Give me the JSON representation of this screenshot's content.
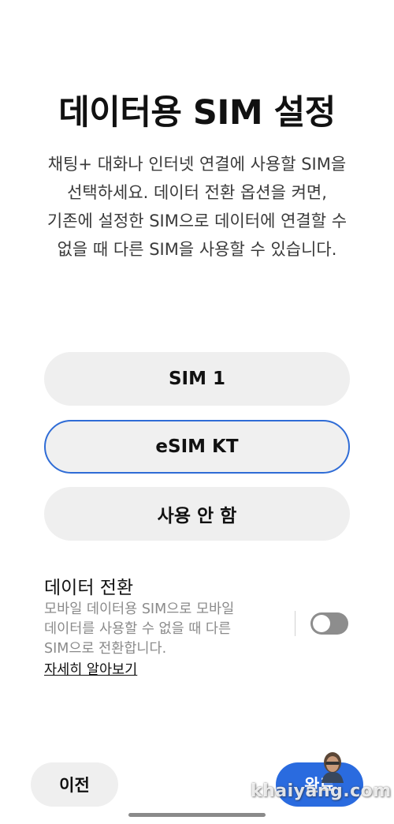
{
  "header": {
    "title": "데이터용 SIM 설정",
    "description_lines": [
      "채팅+ 대화나 인터넷 연결에 사용할 SIM을",
      "선택하세요. 데이터 전환 옵션을 켜면,",
      "기존에 설정한 SIM으로 데이터에 연결할 수",
      "없을 때 다른 SIM을 사용할 수 있습니다."
    ]
  },
  "options": [
    {
      "label": "SIM 1",
      "selected": false
    },
    {
      "label": "eSIM KT",
      "selected": true
    },
    {
      "label": "사용 안 함",
      "selected": false
    }
  ],
  "data_switch": {
    "title": "데이터 전환",
    "description_lines": [
      "모바일 데이터용 SIM으로 모바일",
      "데이터를 사용할 수 없을 때 다른",
      "SIM으로 전환합니다."
    ],
    "learn_more": "자세히 알아보기",
    "enabled": false
  },
  "footer": {
    "prev_label": "이전",
    "done_label": "완료"
  },
  "watermark": "khaiyang.com",
  "colors": {
    "accent": "#2a6bdf",
    "selected_border": "#2f6cd6",
    "option_bg": "#efefef",
    "toggle_off": "#8d8d8d"
  }
}
